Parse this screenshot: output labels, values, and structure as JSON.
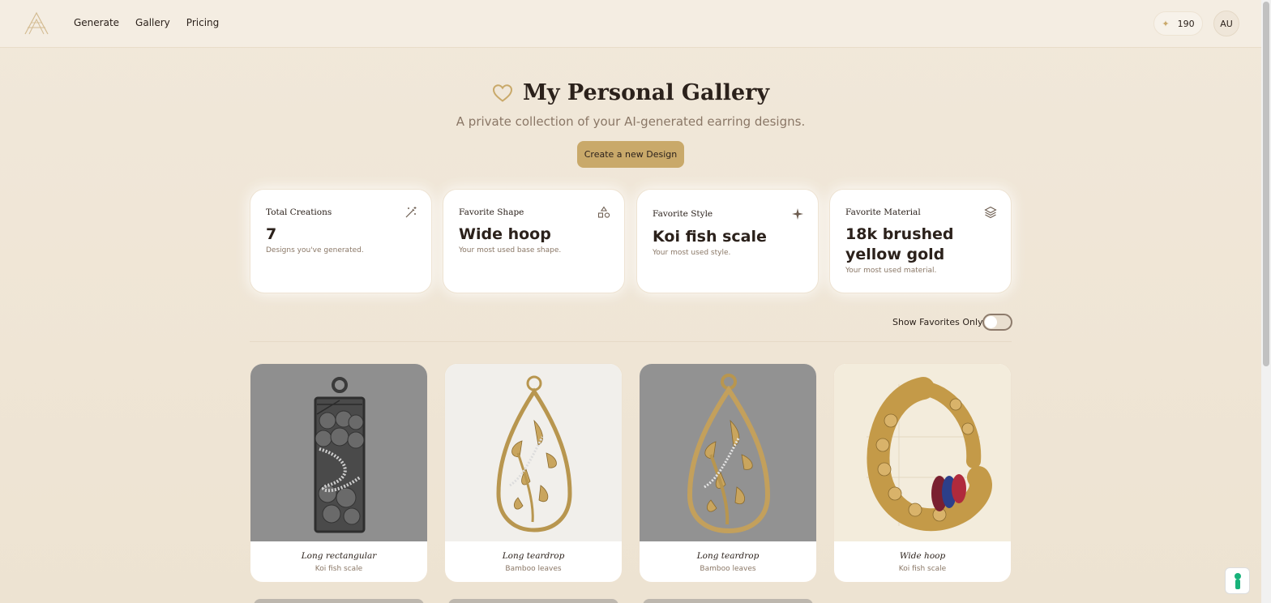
{
  "header": {
    "nav": [
      "Generate",
      "Gallery",
      "Pricing"
    ],
    "credits": "190",
    "avatar": "AU"
  },
  "hero": {
    "title": "My Personal Gallery",
    "subtitle": "A private collection of your AI-generated earring designs.",
    "cta": "Create a new Design"
  },
  "stats": [
    {
      "label": "Total Creations",
      "value": "7",
      "desc": "Designs you've generated.",
      "icon": "magic-wand-icon"
    },
    {
      "label": "Favorite Shape",
      "value": "Wide hoop",
      "desc": "Your most used base shape.",
      "icon": "shapes-icon"
    },
    {
      "label": "Favorite Style",
      "value": "Koi fish scale",
      "desc": "Your most used style.",
      "icon": "sparkle-icon"
    },
    {
      "label": "Favorite Material",
      "value": "18k brushed yellow gold",
      "desc": "Your most used material.",
      "icon": "layers-icon"
    }
  ],
  "filter": {
    "favorites_label": "Show Favorites Only",
    "favorites_on": false
  },
  "gallery": [
    {
      "shape": "Long rectangular",
      "style": "Koi fish scale"
    },
    {
      "shape": "Long teardrop",
      "style": "Bamboo leaves"
    },
    {
      "shape": "Long teardrop",
      "style": "Bamboo leaves"
    },
    {
      "shape": "Wide hoop",
      "style": "Koi fish scale"
    }
  ],
  "colors": {
    "accent": "#c9a96a",
    "background": "#f1e8da",
    "text": "#2b211b",
    "muted": "#8a7766"
  }
}
